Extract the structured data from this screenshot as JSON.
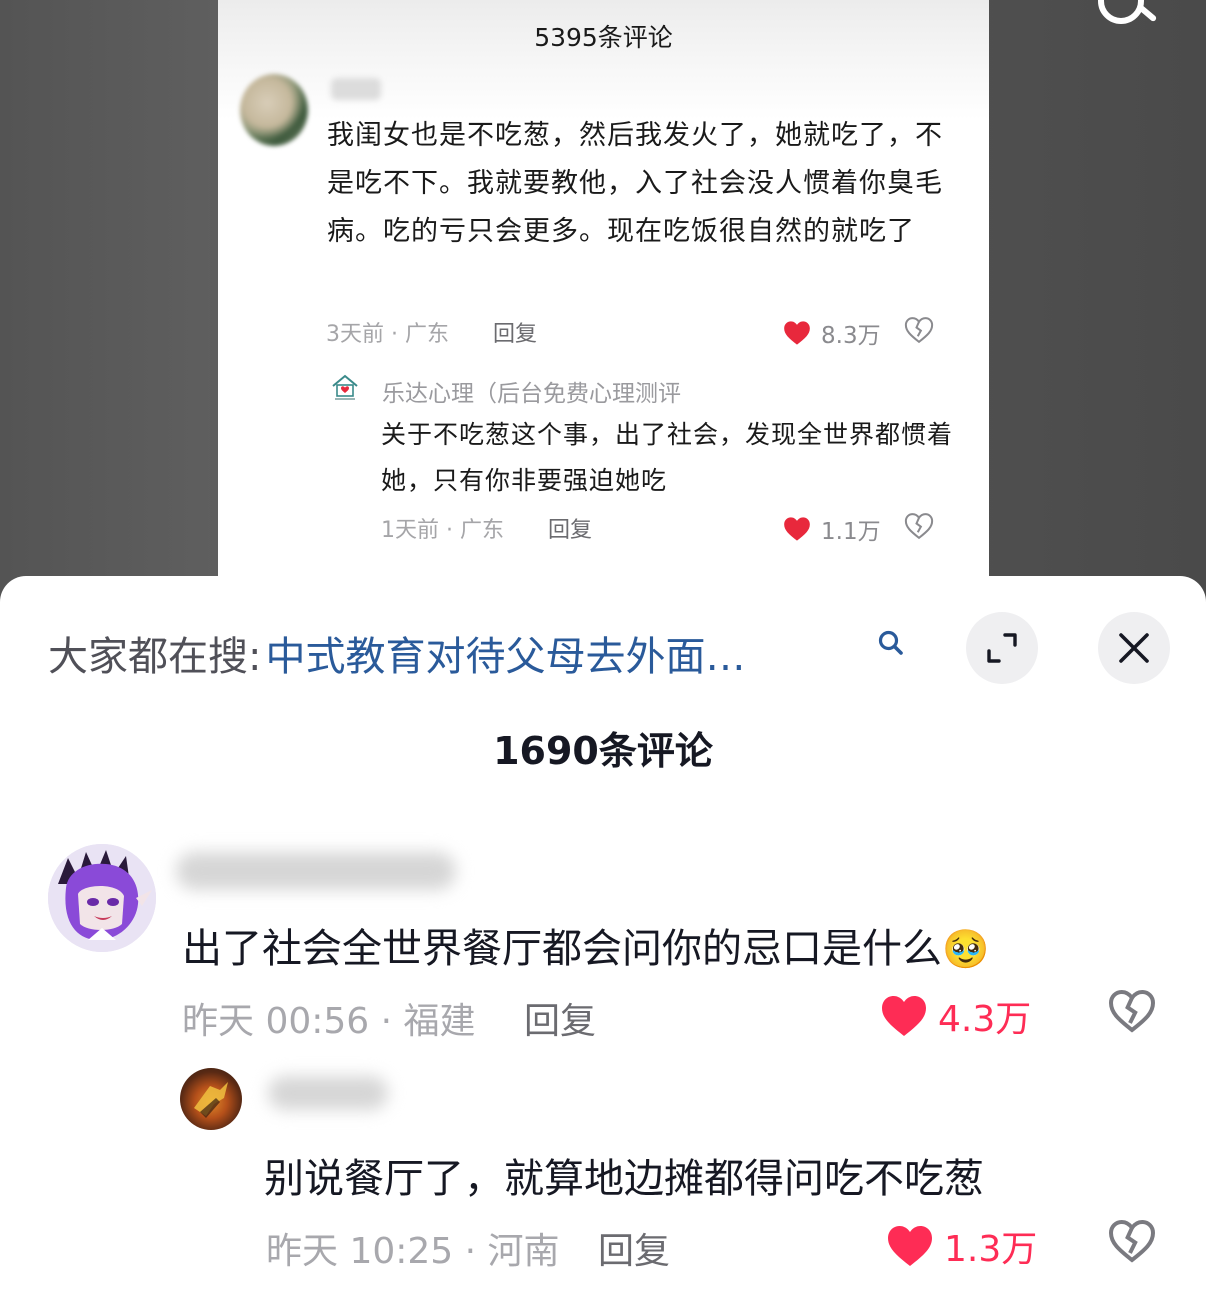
{
  "inner_post": {
    "comment_count": "5395条评论",
    "comment": {
      "text": "我闺女也是不吃葱，然后我发火了，她就吃了，不是吃不下。我就要教他，入了社会没人惯着你臭毛病。吃的亏只会更多。现在吃饭很自然的就吃了",
      "meta": "3天前 · 广东",
      "reply_label": "回复",
      "likes": "8.3万"
    },
    "reply": {
      "author": "乐达心理（后台免费心理测评",
      "text": "关于不吃葱这个事，出了社会，发现全世界都惯着她，只有你非要强迫她吃",
      "meta": "1天前 · 广东",
      "reply_label": "回复",
      "likes": "1.1万"
    }
  },
  "sheet": {
    "search_prefix": "大家都在搜:",
    "search_query": "中式教育对待父母去外面…",
    "comment_count": "1690条评论",
    "comments": [
      {
        "text": "出了社会全世界餐厅都会问你的忌口是什么",
        "emoji": "🥹",
        "meta": "昨天 00:56 · 福建",
        "reply_label": "回复",
        "likes": "4.3万"
      },
      {
        "text": "别说餐厅了，就算地边摊都得问吃不吃葱",
        "meta": "昨天 10:25 · 河南",
        "reply_label": "回复",
        "likes": "1.3万"
      }
    ]
  },
  "icons": {
    "heart": "heart-icon",
    "dislike": "broken-heart-icon",
    "search": "search-icon",
    "expand": "expand-icon",
    "close": "close-icon"
  },
  "colors": {
    "like_red": "#fe2c55",
    "search_link": "#2a5a9a",
    "meta_gray": "#a8a8ad"
  }
}
